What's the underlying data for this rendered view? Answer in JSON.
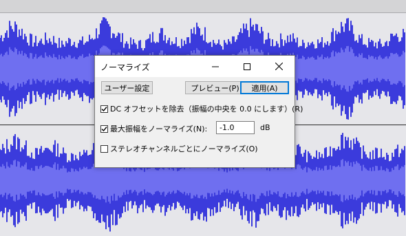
{
  "colors": {
    "waveform_outer": "#3b3bdc",
    "waveform_inner": "#6f6ff0",
    "track_bg": "#e6e6ea",
    "dialog_accent": "#0078d7"
  },
  "dialog": {
    "title": "ノーマライズ",
    "buttons": {
      "user_settings": "ユーザー設定",
      "preview": "プレビュー(P)",
      "apply": "適用(A)"
    },
    "options": {
      "dc_offset": {
        "label": "DC オフセットを除去（振幅の中央を 0.0 にします）(R)",
        "checked": true
      },
      "normalize_max": {
        "label": "最大振幅をノーマライズ(N):",
        "checked": true,
        "value": "-1.0",
        "unit": "dB"
      },
      "stereo_independent": {
        "label": "ステレオチャンネルごとにノーマライズ(O)",
        "checked": false
      }
    },
    "window_controls": [
      "minimize-icon",
      "maximize-icon",
      "close-icon"
    ]
  }
}
